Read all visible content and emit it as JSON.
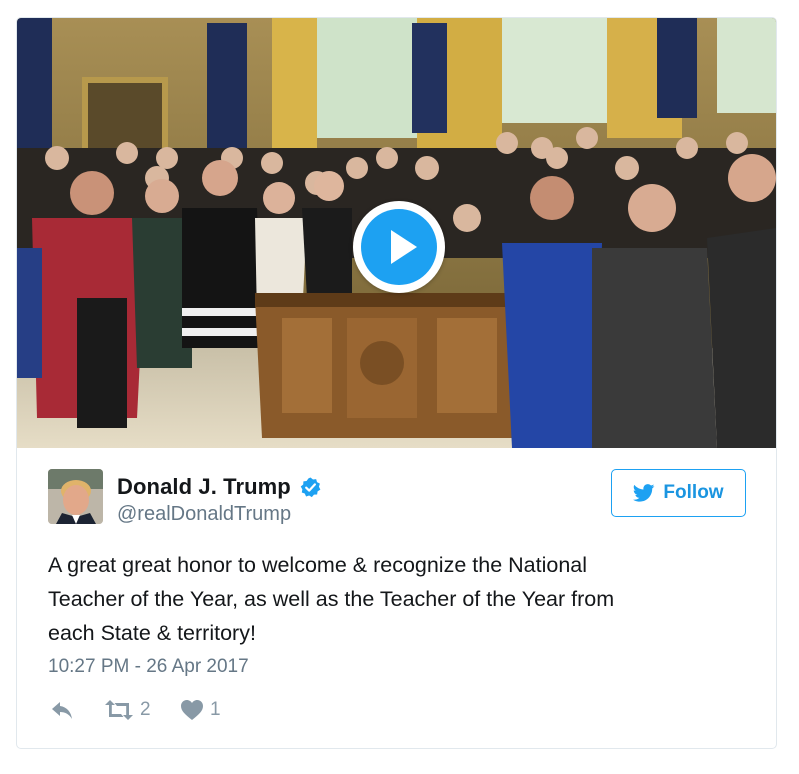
{
  "media": {
    "icon": "play-icon",
    "accent_color": "#1da1f2"
  },
  "author": {
    "name": "Donald J. Trump",
    "handle": "@realDonaldTrump",
    "verified_icon": "verified-badge-icon"
  },
  "follow": {
    "label": "Follow",
    "icon": "twitter-bird-icon",
    "color": "#1da1f2"
  },
  "tweet": {
    "lines": [
      "A great great honor to welcome & recognize the National",
      "Teacher of the Year, as well as the Teacher of the Year from",
      "each State & territory!"
    ],
    "timestamp": "10:27 PM - 26 Apr 2017"
  },
  "actions": {
    "reply_icon": "reply-icon",
    "retweet_icon": "retweet-icon",
    "retweet_count": "2",
    "like_icon": "heart-icon",
    "like_count": "1"
  },
  "colors": {
    "text": "#14171a",
    "secondary": "#657786",
    "action_gray": "#8899a6",
    "border": "#e1e8ed"
  }
}
